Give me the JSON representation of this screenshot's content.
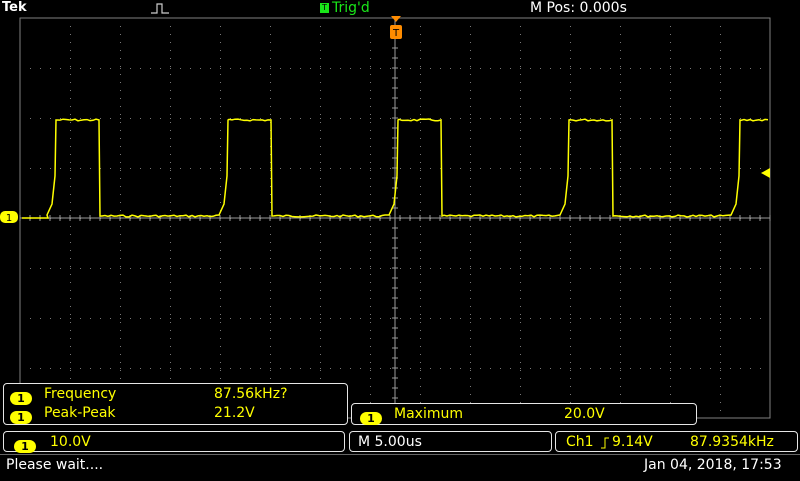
{
  "header": {
    "brand": "Tek",
    "trigger_state": "Trig'd",
    "trigger_badge": "T",
    "mpos": "M Pos: 0.000s"
  },
  "channel": {
    "marker": "1",
    "color": "#ffff00"
  },
  "measurements": [
    {
      "ch": "1",
      "name": "Frequency",
      "value": "87.56kHz?"
    },
    {
      "ch": "1",
      "name": "Peak-Peak",
      "value": "21.2V"
    },
    {
      "ch": "1",
      "name": "Maximum",
      "value": "20.0V"
    }
  ],
  "status": {
    "ch_scale_badge": "1",
    "ch_scale": "10.0V",
    "timebase": "M 5.00us",
    "trigger_source": "Ch1",
    "trigger_slope_icon": "rising-edge",
    "trigger_level": "9.14V",
    "trigger_freq": "87.9354kHz"
  },
  "footer": {
    "message": "Please wait....",
    "datetime": "Jan 04, 2018, 17:53"
  },
  "colors": {
    "trace": "#ffff00",
    "grid": "#808080",
    "trigger": "#ff8c00",
    "trig_green": "#19e619"
  }
}
